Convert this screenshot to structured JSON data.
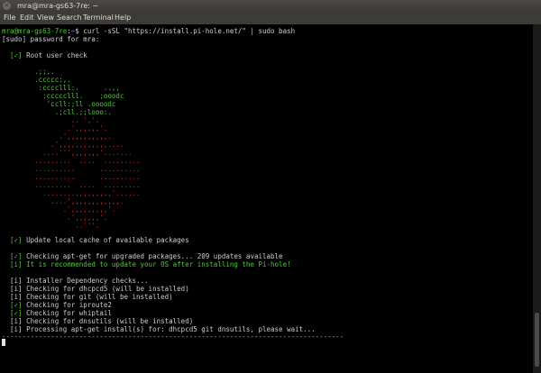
{
  "window": {
    "title": "mra@mra-gs63-7re: ~",
    "close_glyph": "×"
  },
  "menu": {
    "items": [
      "File",
      "Edit",
      "View",
      "Search",
      "Terminal",
      "Help"
    ]
  },
  "terminal": {
    "prompt_user": "mra@mra-gs63-7re",
    "prompt_sep": ":",
    "prompt_path": "~",
    "prompt_symbol": "$ ",
    "command": "curl -sSL \"https://install.pi-hole.net/\" | sudo bash",
    "sudo_prompt": "[sudo] password for mra:",
    "root_check": {
      "mark": "[✓]",
      "text": " Root user check"
    },
    "logo_green": [
      "        .;;,.",
      "        .ccccc:,.",
      "         :cccclll:.      ..,,",
      "          :ccccclll.    ;ooodc",
      "           'ccll:;ll .oooodc",
      "             .;cll.;;looo:."
    ],
    "logo_red": [
      "                 .. ','.",
      "                .',,,,,,'.",
      "              .',,,,,,,,,,.",
      "            .',,,,,,,,,,,,....",
      "          ....''',,,,,,,'.......",
      "        .........  ....  .........",
      "        ..........      ..........",
      "        ..........      ..........",
      "        .........  ....  .........",
      "          ........,,,,,,,,,'......",
      "            ....',,,,,,,,,,,,.",
      "               .',,,,,,,,,'.",
      "                .',,,,,,'.",
      "                  ..'''."
    ],
    "update_cache": {
      "mark": "[✓]",
      "text": " Update local cache of available packages"
    },
    "apt_check": {
      "mark": "[✓]",
      "text": " Checking apt-get for upgraded packages... 209 updates available"
    },
    "recommend": {
      "mark": "[i]",
      "text": " It is recommended to update your OS after installing the Pi-hole!"
    },
    "deps": [
      {
        "mark": "[i]",
        "text": " Installer Dependency checks...",
        "ok": false
      },
      {
        "mark": "[i]",
        "text": " Checking for dhcpcd5 (will be installed)",
        "ok": false
      },
      {
        "mark": "[i]",
        "text": " Checking for git (will be installed)",
        "ok": false
      },
      {
        "mark": "[✓]",
        "text": " Checking for iproute2",
        "ok": true
      },
      {
        "mark": "[✓]",
        "text": " Checking for whiptail",
        "ok": true
      },
      {
        "mark": "[i]",
        "text": " Checking for dnsutils (will be installed)",
        "ok": false
      },
      {
        "mark": "[i]",
        "text": " Processing apt-get install(s) for: dhcpcd5 git dnsutils, please wait...",
        "ok": false
      }
    ],
    "divider": "------------------------------------------------------------------------------------"
  }
}
